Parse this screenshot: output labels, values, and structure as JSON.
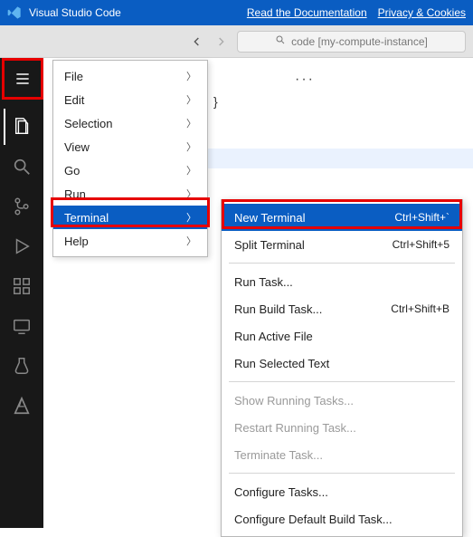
{
  "titlebar": {
    "app_name": "Visual Studio Code",
    "links": {
      "docs": "Read the Documentation",
      "privacy": "Privacy & Cookies"
    }
  },
  "toolbar": {
    "search_text": "code [my-compute-instance]"
  },
  "activity": {
    "items": [
      "menu",
      "explorer",
      "search",
      "source-control",
      "run-debug",
      "extensions",
      "remote",
      "testing",
      "azure"
    ]
  },
  "menu1": {
    "items": [
      {
        "label": "File"
      },
      {
        "label": "Edit"
      },
      {
        "label": "Selection"
      },
      {
        "label": "View"
      },
      {
        "label": "Go"
      },
      {
        "label": "Run"
      },
      {
        "label": "Terminal",
        "selected": true
      },
      {
        "label": "Help"
      }
    ]
  },
  "menu2": {
    "groups": [
      [
        {
          "label": "New Terminal",
          "kbd": "Ctrl+Shift+`",
          "selected": true
        },
        {
          "label": "Split Terminal",
          "kbd": "Ctrl+Shift+5"
        }
      ],
      [
        {
          "label": "Run Task..."
        },
        {
          "label": "Run Build Task...",
          "kbd": "Ctrl+Shift+B"
        },
        {
          "label": "Run Active File"
        },
        {
          "label": "Run Selected Text"
        }
      ],
      [
        {
          "label": "Show Running Tasks...",
          "disabled": true
        },
        {
          "label": "Restart Running Task...",
          "disabled": true
        },
        {
          "label": "Terminate Task...",
          "disabled": true
        }
      ],
      [
        {
          "label": "Configure Tasks..."
        },
        {
          "label": "Configure Default Build Task..."
        }
      ]
    ]
  },
  "editor": {
    "ellipsis": "···",
    "brace": "}"
  }
}
